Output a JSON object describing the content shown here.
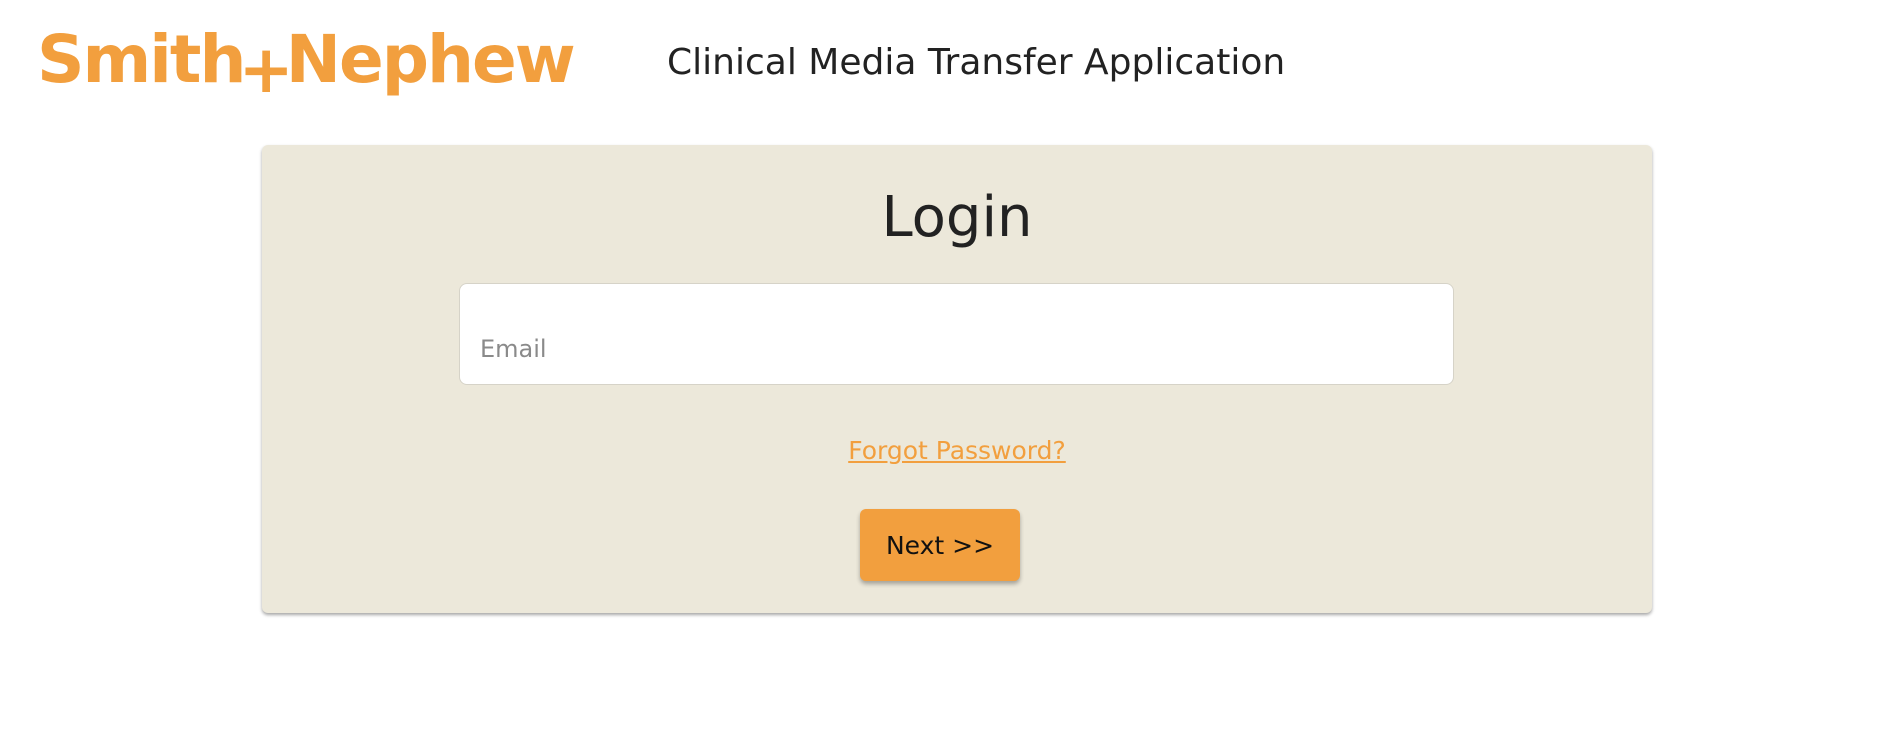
{
  "header": {
    "logo_left": "Smith",
    "logo_plus": "+",
    "logo_right": "Nephew",
    "app_title": "Clinical Media Transfer Application"
  },
  "login": {
    "heading": "Login",
    "email_placeholder": "Email",
    "email_value": "",
    "forgot_password": "Forgot Password?",
    "next_button": "Next >>"
  },
  "colors": {
    "brand_orange": "#F29F3E",
    "card_background": "#ECE8DA",
    "text_dark": "#222222"
  }
}
